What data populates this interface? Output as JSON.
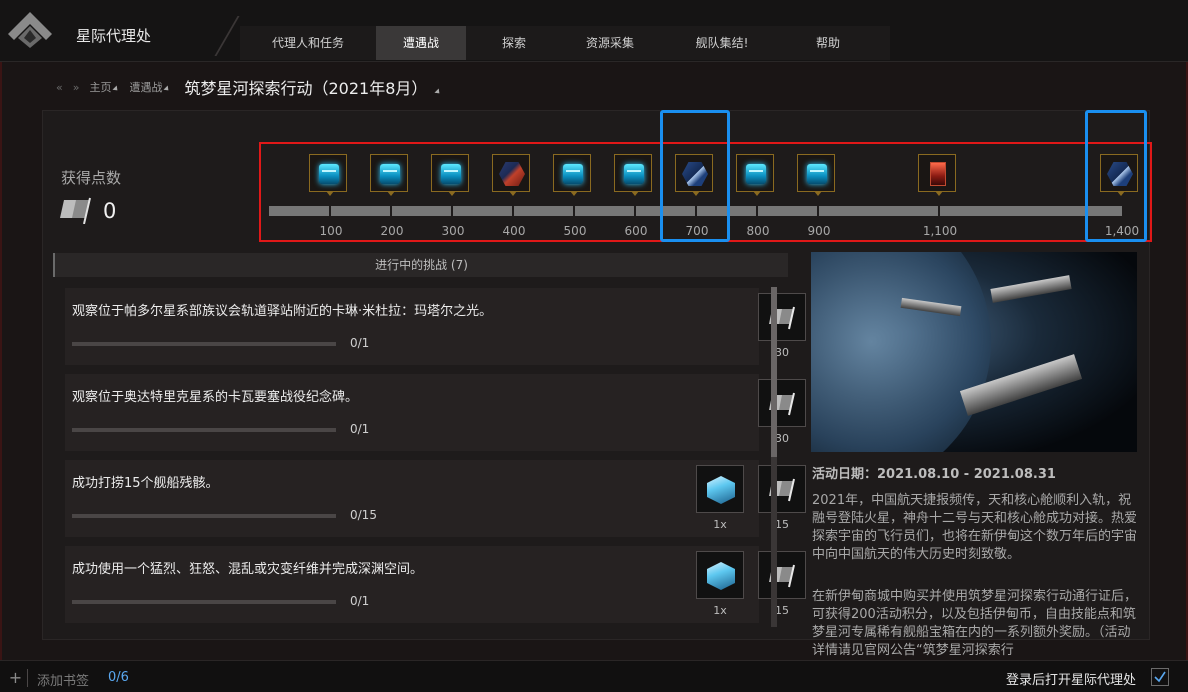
{
  "app": {
    "title": "星际代理处"
  },
  "nav": {
    "tabs": [
      {
        "label": "代理人和任务",
        "active": false
      },
      {
        "label": "遭遇战",
        "active": true
      },
      {
        "label": "探索",
        "active": false
      },
      {
        "label": "资源采集",
        "active": false
      },
      {
        "label": "舰队集结!",
        "active": false
      },
      {
        "label": "帮助",
        "active": false
      }
    ]
  },
  "breadcrumb": {
    "back": "«",
    "forward": "»",
    "items": [
      "主页",
      "遭遇战"
    ],
    "page_title": "筑梦星河探索行动（2021年8月）"
  },
  "points": {
    "label": "获得点数",
    "value": "0"
  },
  "reward_track": {
    "milestones": [
      {
        "label": "100",
        "reward": "blue-crate"
      },
      {
        "label": "200",
        "reward": "blue-crate"
      },
      {
        "label": "300",
        "reward": "blue-crate"
      },
      {
        "label": "400",
        "reward": "red-ship-skin"
      },
      {
        "label": "500",
        "reward": "blue-crate"
      },
      {
        "label": "600",
        "reward": "blue-crate"
      },
      {
        "label": "700",
        "reward": "blue-ship-skin",
        "highlighted": true
      },
      {
        "label": "800",
        "reward": "blue-crate"
      },
      {
        "label": "900",
        "reward": "blue-crate"
      },
      {
        "label": "1,100",
        "reward": "red-container"
      },
      {
        "label": "1,400",
        "reward": "blue-ship-skin",
        "highlighted": true
      }
    ]
  },
  "challenges": {
    "header": "进行中的挑战 (7)",
    "items": [
      {
        "title": "观察位于帕多尔星系部族议会轨道驿站附近的卡琳·米杜拉：玛塔尔之光。",
        "progress": "0/1",
        "rewards": [
          {
            "icon": "flag-icon",
            "amount": "30"
          }
        ]
      },
      {
        "title": "观察位于奥达特里克星系的卡瓦要塞战役纪念碑。",
        "progress": "0/1",
        "rewards": [
          {
            "icon": "flag-icon",
            "amount": "30"
          }
        ]
      },
      {
        "title": "成功打捞15个舰船残骸。",
        "progress": "0/15",
        "rewards": [
          {
            "icon": "cube-icon",
            "amount": "1x"
          },
          {
            "icon": "flag-icon",
            "amount": "15"
          }
        ]
      },
      {
        "title": "成功使用一个猛烈、狂怒、混乱或灾变纤维并完成深渊空间。",
        "progress": "0/1",
        "rewards": [
          {
            "icon": "cube-icon",
            "amount": "1x"
          },
          {
            "icon": "flag-icon",
            "amount": "15"
          }
        ]
      }
    ]
  },
  "event": {
    "date": "活动日期：2021.08.10 - 2021.08.31",
    "para1": "2021年，中国航天捷报频传，天和核心舱顺利入轨，祝融号登陆火星，神舟十二号与天和核心舱成功对接。热爱探索宇宙的飞行员们，也将在新伊甸这个数万年后的宇宙中向中国航天的伟大历史时刻致敬。",
    "para2": "在新伊甸商城中购买并使用筑梦星河探索行动通行证后，可获得200活动积分，以及包括伊甸币，自由技能点和筑梦星河专属稀有舰船宝箱在内的一系列额外奖励。（活动详情请见官网公告“筑梦星河探索行"
  },
  "bottom": {
    "add_bookmark_label": "添加书签",
    "bookmark_count": "0/6",
    "login_open_label": "登录后打开星际代理处",
    "login_open_checked": true
  },
  "colors": {
    "highlight_red": "#e01818",
    "highlight_blue": "#1a8ff0",
    "accent_blue": "#5aa8f0"
  }
}
